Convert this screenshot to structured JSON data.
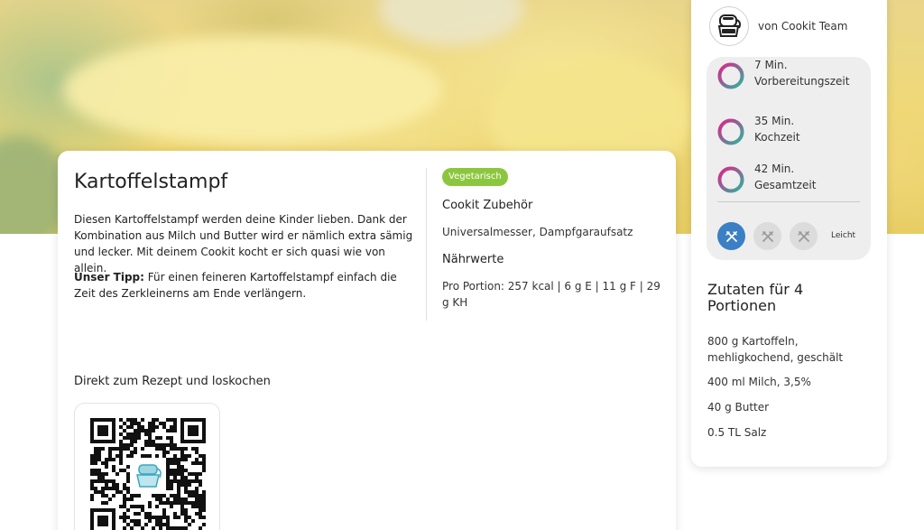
{
  "recipe": {
    "title": "Kartoffelstampf",
    "description": "Diesen Kartoffelstampf werden deine Kinder lieben. Dank der Kombination aus Milch und Butter wird er nämlich extra sämig und lecker. Mit deinem Cookit kocht er sich quasi wie von allein.",
    "tip_label": "Unser Tipp:",
    "tip_text": " Für einen feineren Kartoffelstampf einfach die Zeit des Zerkleinerns am Ende verlängern.",
    "badge": "Vegetarisch",
    "accessories_heading": "Cookit Zubehör",
    "accessories": "Universalmesser, Dampfgaraufsatz",
    "nutrition_heading": "Nährwerte",
    "nutrition": "Pro Portion: 257 kcal | 6 g E | 11 g F | 29 g KH",
    "direct_heading": "Direkt zum Rezept und loskochen"
  },
  "sidebar": {
    "author": "von Cookit Team",
    "times": [
      {
        "value": "7 Min.",
        "label": "Vorbereitungszeit"
      },
      {
        "value": "35 Min.",
        "label": "Kochzeit"
      },
      {
        "value": "42 Min.",
        "label": "Gesamtzeit"
      }
    ],
    "difficulty_label": "Leicht",
    "difficulty_level": 1,
    "difficulty_max": 3,
    "ingredients_heading": "Zutaten für 4 Portionen",
    "ingredients": [
      "800 g Kartoffeln, mehligkochend, geschält",
      "400 ml Milch, 3,5%",
      "40 g Butter",
      "0.5 TL Salz"
    ]
  },
  "colors": {
    "badge": "#8cc63f",
    "ring_start": "#e0218a",
    "ring_end": "#2bb5a0",
    "difficulty_active": "#3b7fc4",
    "difficulty_inactive": "#dcdcdc"
  },
  "icons": {
    "author_avatar": "cookit-machine-icon",
    "difficulty": "fork-knife-icon",
    "qr_center": "cookit-machine-icon"
  }
}
